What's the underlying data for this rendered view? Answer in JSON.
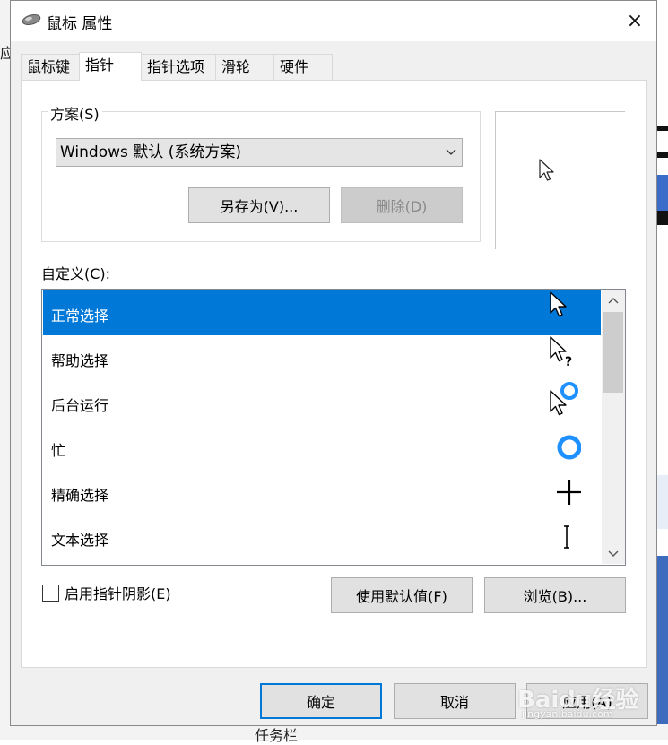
{
  "window": {
    "title": "鼠标 属性",
    "close_icon": "×"
  },
  "tabs": [
    {
      "label": "鼠标键",
      "active": false
    },
    {
      "label": "指针",
      "active": true
    },
    {
      "label": "指针选项",
      "active": false
    },
    {
      "label": "滑轮",
      "active": false
    },
    {
      "label": "硬件",
      "active": false
    }
  ],
  "scheme": {
    "group_label": "方案(S)",
    "selected": "Windows 默认 (系统方案)",
    "dropdown_icon": "chevron-down-icon",
    "save_as_label": "另存为(V)...",
    "delete_label": "删除(D)"
  },
  "customize": {
    "label": "自定义(C):",
    "items": [
      {
        "label": "正常选择",
        "icon": "arrow-cursor-icon",
        "selected": true
      },
      {
        "label": "帮助选择",
        "icon": "help-cursor-icon",
        "selected": false
      },
      {
        "label": "后台运行",
        "icon": "working-in-background-cursor-icon",
        "selected": false
      },
      {
        "label": "忙",
        "icon": "busy-cursor-icon",
        "selected": false
      },
      {
        "label": "精确选择",
        "icon": "crosshair-cursor-icon",
        "selected": false
      },
      {
        "label": "文本选择",
        "icon": "text-beam-cursor-icon",
        "selected": false
      }
    ]
  },
  "options": {
    "shadow_label": "启用指针阴影(E)",
    "shadow_checked": false,
    "use_default_label": "使用默认值(F)",
    "browse_label": "浏览(B)..."
  },
  "footer": {
    "ok_label": "确定",
    "cancel_label": "取消",
    "apply_label": "应用(A)"
  },
  "background": {
    "left_char": "应",
    "bottom_text": "任务栏"
  },
  "watermark": {
    "text": "Baidu经验",
    "sub": "jingyan.baidu.com"
  },
  "colors": {
    "accent": "#0078d7",
    "dialog_bg": "#f0f0f0",
    "selection": "#0078d7"
  }
}
